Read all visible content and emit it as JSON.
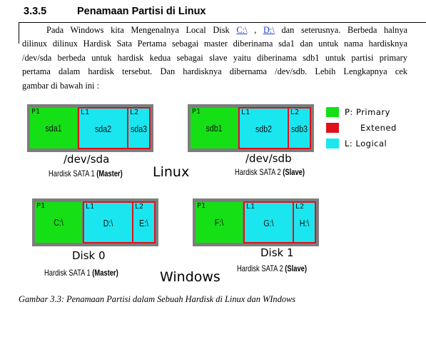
{
  "section": {
    "number": "3.3.5",
    "title": "Penamaan Partisi di Linux"
  },
  "paragraph": {
    "l1_a": "Pada Windows kita Mengenalnya Local Disk ",
    "link1": "C:\\",
    "l1_b": " , ",
    "link2": "D:\\",
    "l1_c": " dan seterusnya. Berbeda halnya",
    "l2": "dilinux dilinux Hardisk Sata Pertama sebagai master diberinama sda1 dan untuk nama hardisknya",
    "l3": "/dev/sda berbeda untuk hardisk kedua sebagai slave yaitu diberinama sdb1 untuk partisi primary",
    "l4": "pertama dalam hardisk tersebut. Dan hardisknya dibernama /dev/sdb. Lebih Lengkapnya cek",
    "l5": "gambar di bawah ini :"
  },
  "figure": {
    "linux_label": "Linux",
    "windows_label": "Windows",
    "disks": [
      {
        "device": "/dev/sda",
        "sata_prefix": "Hardisk SATA 1 ",
        "sata_role": "(Master)",
        "partitions": [
          {
            "tag": "P1",
            "name": "sda1"
          },
          {
            "tag": "L1",
            "name": "sda2"
          },
          {
            "tag": "L2",
            "name": "sda3"
          }
        ]
      },
      {
        "device": "/dev/sdb",
        "sata_prefix": "Hardisk SATA 2 ",
        "sata_role": "(Slave)",
        "partitions": [
          {
            "tag": "P1",
            "name": "sdb1"
          },
          {
            "tag": "L1",
            "name": "sdb2"
          },
          {
            "tag": "L2",
            "name": "sdb3"
          }
        ]
      },
      {
        "device": "Disk 0",
        "sata_prefix": "Hardisk SATA 1 ",
        "sata_role": "(Master)",
        "partitions": [
          {
            "tag": "P1",
            "name": "C:\\"
          },
          {
            "tag": "L1",
            "name": "D:\\"
          },
          {
            "tag": "L2",
            "name": "E:\\"
          }
        ]
      },
      {
        "device": "Disk 1",
        "sata_prefix": "Hardisk SATA 2 ",
        "sata_role": "(Slave)",
        "partitions": [
          {
            "tag": "P1",
            "name": "F:\\"
          },
          {
            "tag": "L1",
            "name": "G:\\"
          },
          {
            "tag": "L2",
            "name": "H:\\"
          }
        ]
      }
    ],
    "legend": [
      {
        "label": "P: Primary",
        "color": "#15e015"
      },
      {
        "label": "Extened",
        "color": "#e0101a"
      },
      {
        "label": "L: Logical",
        "color": "#1ae6f0"
      }
    ],
    "colors": {
      "primary": "#15e015",
      "extended": "#e0101a",
      "logical": "#1ae6f0",
      "disk_frame": "#7d7d7d"
    }
  },
  "caption": "Gambar 3.3: Penamaan Partisi dalam Sebuah Hardisk di Linux dan WIndows"
}
